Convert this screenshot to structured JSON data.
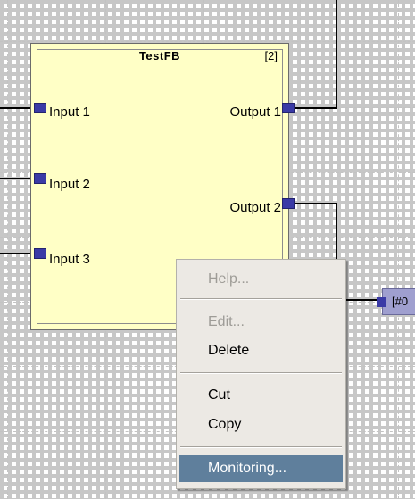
{
  "function_block": {
    "type_name": "TestFB",
    "instance": "[2]",
    "inputs": [
      "Input 1",
      "Input 2",
      "Input 3"
    ],
    "outputs": [
      "Output 1",
      "Output 2"
    ]
  },
  "connected_block": {
    "label": "[#0"
  },
  "context_menu": {
    "help": "Help...",
    "edit": "Edit...",
    "delete": "Delete",
    "cut": "Cut",
    "copy": "Copy",
    "monitoring": "Monitoring..."
  },
  "colors": {
    "block_fill": "#ffffc6",
    "port_fill": "#3a3aa6",
    "menu_bg": "#ece9e4",
    "menu_highlight": "#5f7f9c"
  }
}
